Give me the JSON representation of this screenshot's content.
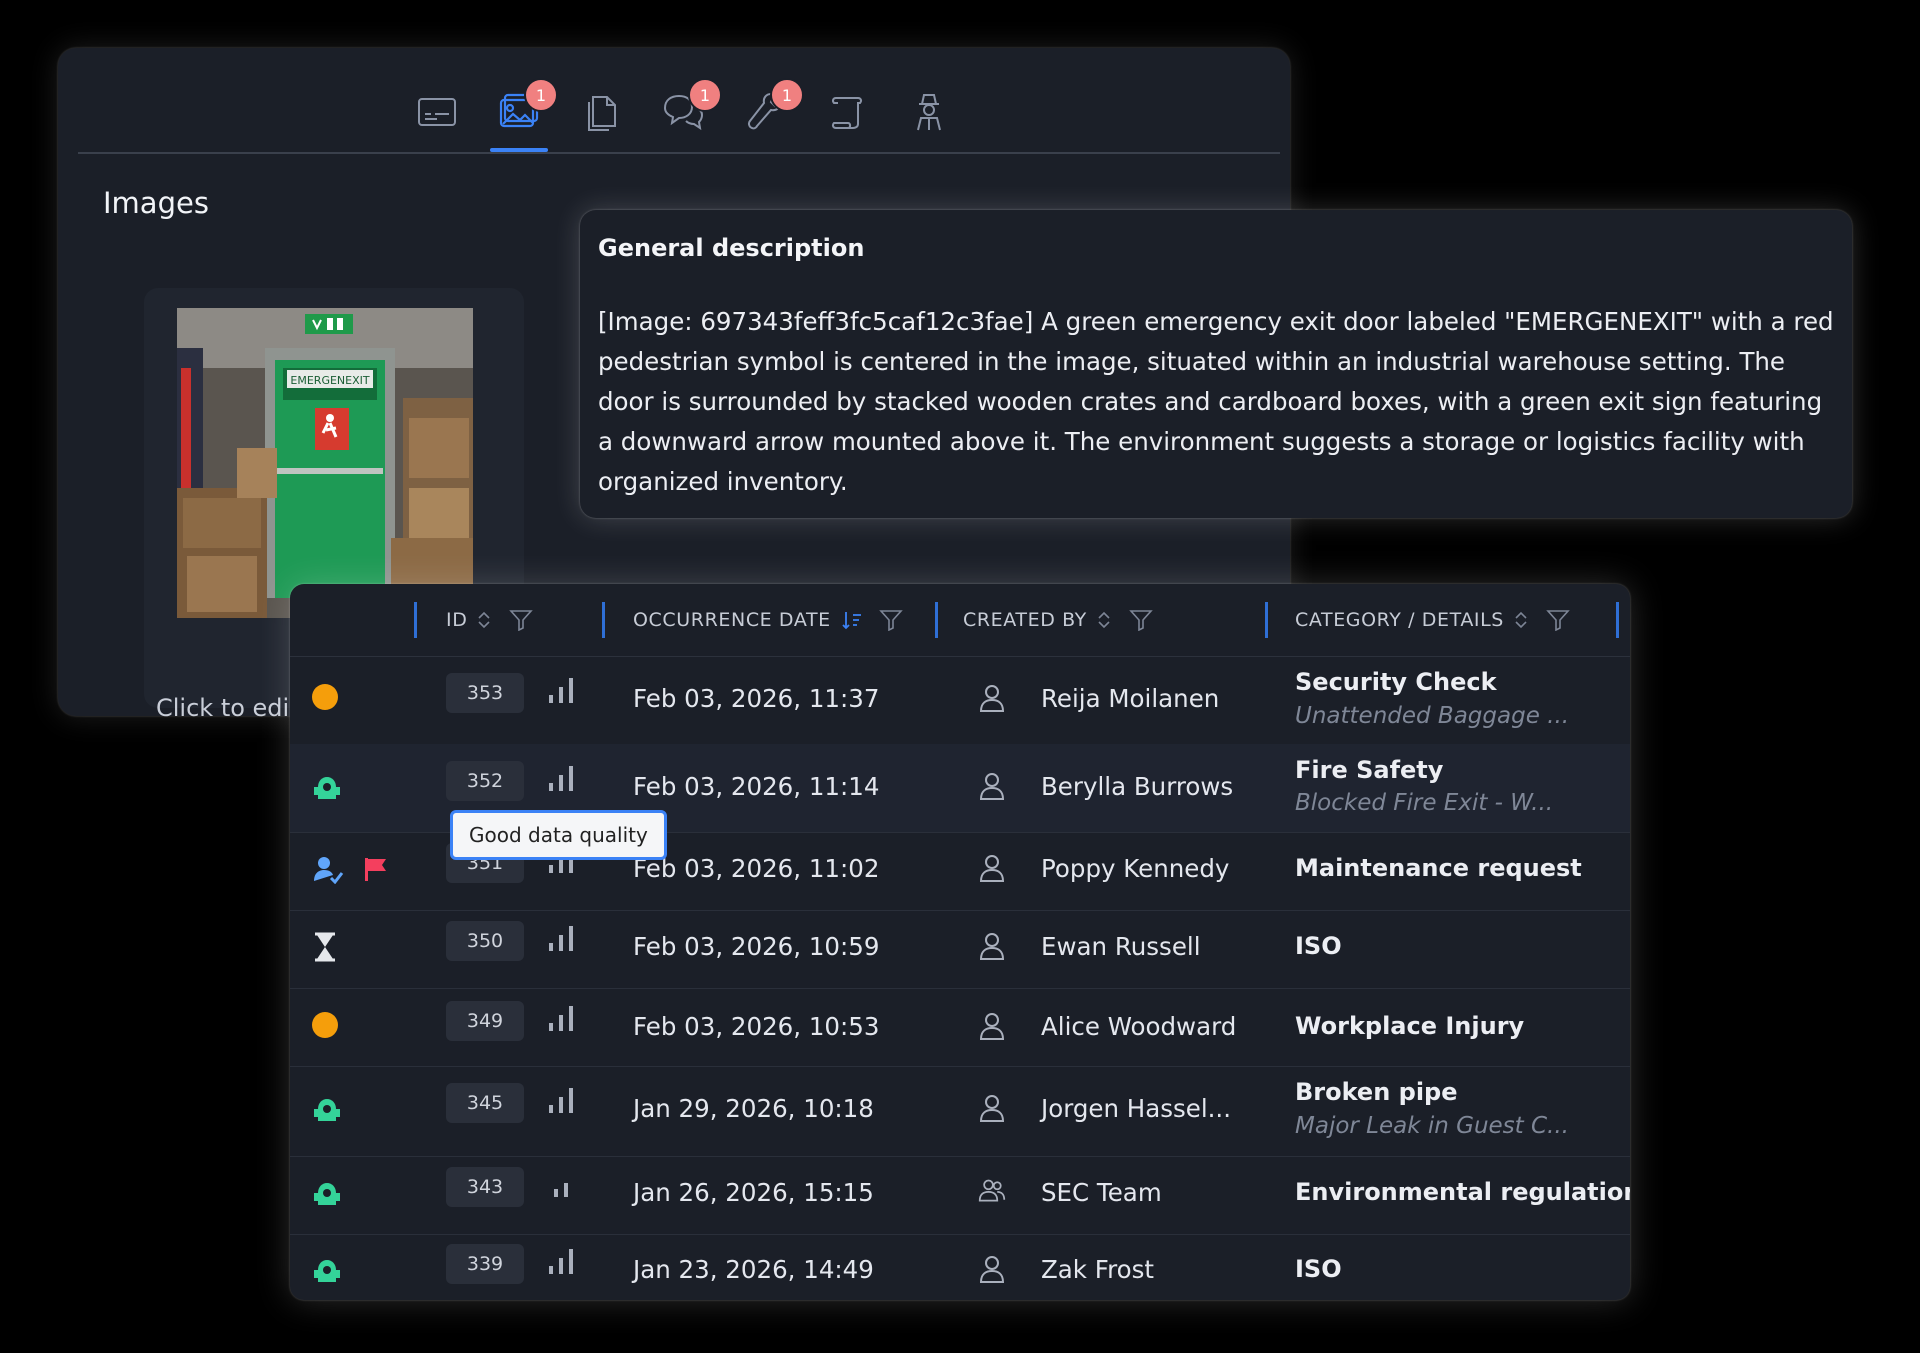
{
  "tabs": [
    {
      "name": "tab-card-icon",
      "badge": ""
    },
    {
      "name": "tab-images-icon",
      "badge": "1"
    },
    {
      "name": "tab-documents-icon",
      "badge": ""
    },
    {
      "name": "tab-comments-icon",
      "badge": "1"
    },
    {
      "name": "tab-tools-icon",
      "badge": "1"
    },
    {
      "name": "tab-scroll-icon",
      "badge": ""
    },
    {
      "name": "tab-investigator-icon",
      "badge": ""
    }
  ],
  "images": {
    "title": "Images",
    "thumbnail_sign": "EMERGENEXIT",
    "click_label": "Click to edi"
  },
  "description": {
    "heading": "General description",
    "text": "[Image: 697343feff3fc5caf12c3fae] A green emergency exit door labeled \"EMERGENEXIT\" with a red pedestrian symbol is centered in the image, situated within an industrial warehouse setting. The door is surrounded by stacked wooden crates and cardboard boxes, with a green exit sign featuring a downward arrow mounted above it. The environment suggests a storage or logistics facility with organized inventory."
  },
  "table": {
    "columns": {
      "id": "ID",
      "occurrence_date": "OCCURRENCE DATE",
      "created_by": "CREATED BY",
      "category": "CATEGORY / DETAILS"
    },
    "tooltip": "Good data quality",
    "rows": [
      {
        "status": "orange-dot",
        "id": "353",
        "date": "Feb 03, 2026, 11:37",
        "creator": "Reija Moilanen",
        "creator_type": "person",
        "category": "Security Check",
        "detail": "Unattended Baggage ..."
      },
      {
        "status": "green-robot",
        "id": "352",
        "date": "Feb 03, 2026, 11:14",
        "creator": "Berylla Burrows",
        "creator_type": "person",
        "category": "Fire Safety",
        "detail": "Blocked Fire Exit - W..."
      },
      {
        "status": "assigned-flag",
        "id": "351",
        "date": "Feb 03, 2026, 11:02",
        "creator": "Poppy Kennedy",
        "creator_type": "person",
        "category": "Maintenance request",
        "detail": ""
      },
      {
        "status": "hourglass",
        "id": "350",
        "date": "Feb 03, 2026, 10:59",
        "creator": "Ewan Russell",
        "creator_type": "person",
        "category": "ISO",
        "detail": ""
      },
      {
        "status": "orange-dot",
        "id": "349",
        "date": "Feb 03, 2026, 10:53",
        "creator": "Alice Woodward",
        "creator_type": "person",
        "category": "Workplace Injury",
        "detail": ""
      },
      {
        "status": "green-robot",
        "id": "345",
        "date": "Jan 29, 2026, 10:18",
        "creator": "Jorgen Hassel...",
        "creator_type": "person",
        "category": "Broken pipe",
        "detail": "Major Leak in Guest C..."
      },
      {
        "status": "green-robot",
        "id": "343",
        "date": "Jan 26, 2026, 15:15",
        "creator": "SEC Team",
        "creator_type": "team",
        "category": "Environmental regulation",
        "detail": ""
      },
      {
        "status": "green-robot",
        "id": "339",
        "date": "Jan 23, 2026, 14:49",
        "creator": "Zak Frost",
        "creator_type": "person",
        "category": "ISO",
        "detail": ""
      }
    ]
  },
  "colors": {
    "accent": "#3b82f6",
    "badge": "#f08080",
    "status_orange": "#f59e0b",
    "status_green": "#34d399",
    "flag_pink": "#f43f5e"
  }
}
